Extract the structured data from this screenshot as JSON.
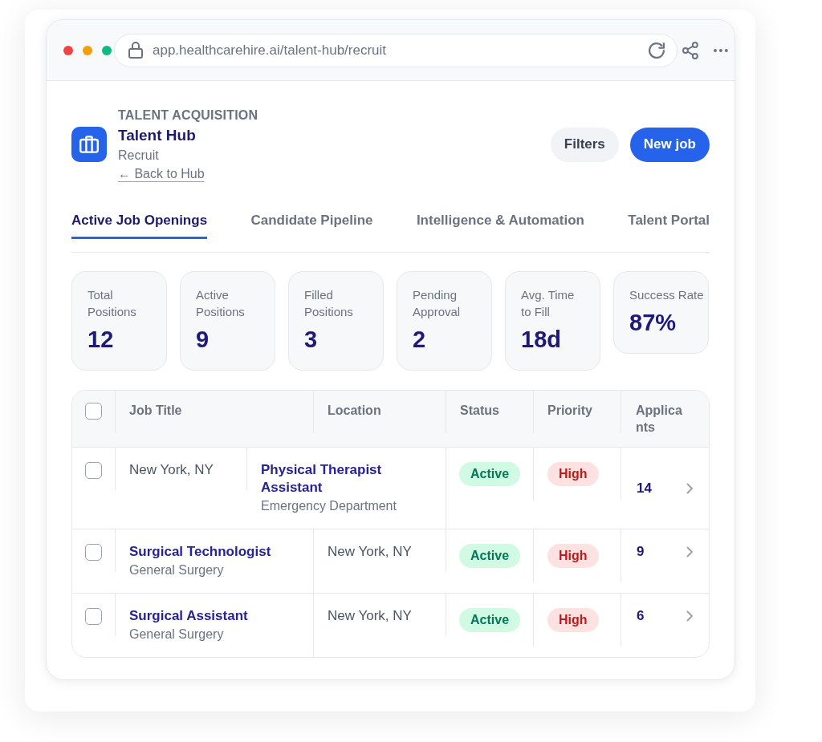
{
  "browser": {
    "url": "app.healthcarehire.ai/talent-hub/recruit"
  },
  "header": {
    "eyebrow": "TALENT ACQUISITION",
    "title": "Talent Hub",
    "subtitle": "Recruit",
    "back_link": "← Back to Hub"
  },
  "actions": [
    {
      "label": "Filters",
      "kind": "secondary"
    },
    {
      "label": "New job",
      "kind": "primary"
    }
  ],
  "tabs": [
    {
      "label": "Active Job Openings",
      "selected": true
    },
    {
      "label": "Candidate Pipeline",
      "selected": false
    },
    {
      "label": "Intelligence & Automation",
      "selected": false
    },
    {
      "label": "Talent Portal",
      "selected": false
    }
  ],
  "stats": [
    {
      "label": "Total Positions",
      "value": "12"
    },
    {
      "label": "Active Positions",
      "value": "9"
    },
    {
      "label": "Filled Positions",
      "value": "3"
    },
    {
      "label": "Pending Approval",
      "value": "2"
    },
    {
      "label": "Avg. Time to Fill",
      "value": "18d"
    },
    {
      "label": "Success Rate",
      "value": "87%"
    }
  ],
  "table": {
    "select_all_checked": false,
    "columns": [
      "Job Title",
      "Location",
      "Status",
      "Priority",
      "Applicants"
    ],
    "rows": [
      {
        "checked": false,
        "job_title": {
          "kind": "plain",
          "text": "New York, NY"
        },
        "location": {
          "kind": "link",
          "text": "Physical Therapist Assistant",
          "detail": "Emergency Department"
        },
        "status": {
          "text": "Active",
          "kind": "success"
        },
        "priority": {
          "text": "High",
          "kind": "danger"
        },
        "applicants": "14"
      },
      {
        "checked": false,
        "job_title": {
          "kind": "link",
          "text": "Surgical Technologist",
          "detail": "General Surgery"
        },
        "location": {
          "kind": "plain",
          "text": "New York, NY"
        },
        "status": {
          "text": "Active",
          "kind": "success"
        },
        "priority": {
          "text": "High",
          "kind": "danger"
        },
        "applicants": "9"
      },
      {
        "checked": false,
        "job_title": {
          "kind": "link",
          "text": "Surgical Assistant",
          "detail": "General Surgery"
        },
        "location": {
          "kind": "plain",
          "text": "New York, NY"
        },
        "status": {
          "text": "Active",
          "kind": "success"
        },
        "priority": {
          "text": "High",
          "kind": "danger"
        },
        "applicants": "6"
      }
    ]
  }
}
